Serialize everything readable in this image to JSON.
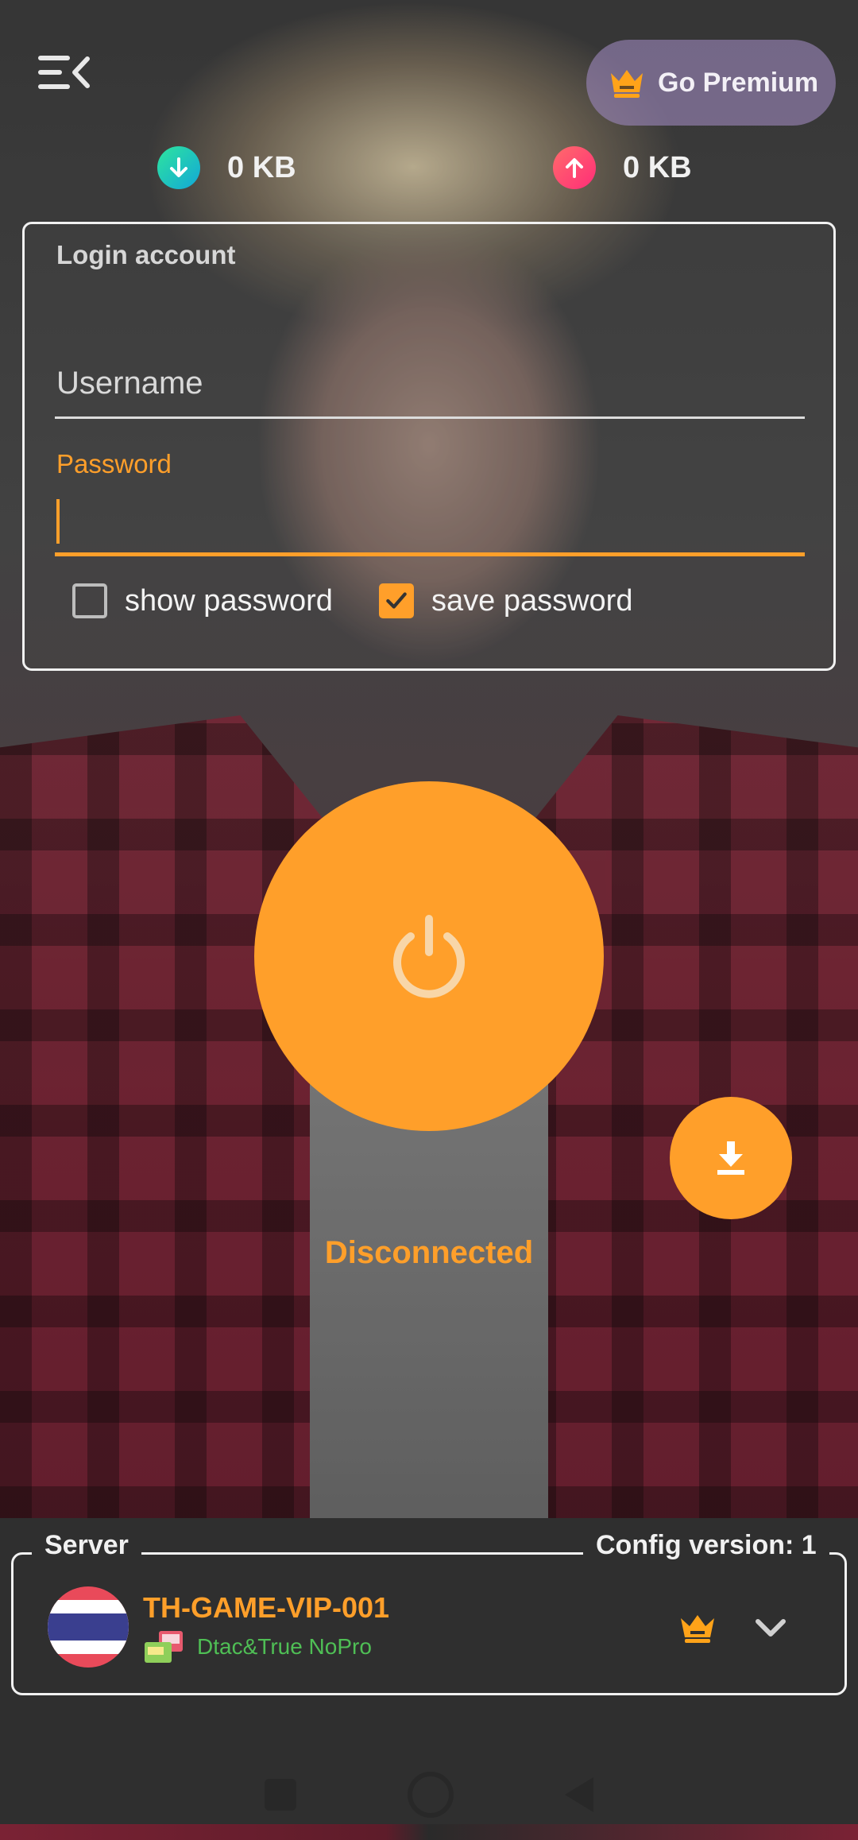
{
  "header": {
    "premium_label": "Go Premium"
  },
  "traffic": {
    "download": "0 KB",
    "upload": "0 KB"
  },
  "login": {
    "title": "Login account",
    "username_placeholder": "Username",
    "password_label": "Password",
    "show_password_label": "show password",
    "show_password_checked": false,
    "save_password_label": "save password",
    "save_password_checked": true
  },
  "connection": {
    "status": "Disconnected"
  },
  "server": {
    "legend": "Server",
    "config_version": "Config version: 1",
    "name": "TH-GAME-VIP-001",
    "subtitle": "Dtac&True NoPro"
  },
  "colors": {
    "accent": "#ff9f2a",
    "subtitle_green": "#4fbf55"
  },
  "icons": [
    "menu-icon",
    "crown-icon",
    "download-arrow-icon",
    "upload-arrow-icon",
    "power-icon",
    "download-icon",
    "thailand-flag-icon",
    "sim-icon",
    "chevron-down-icon"
  ]
}
